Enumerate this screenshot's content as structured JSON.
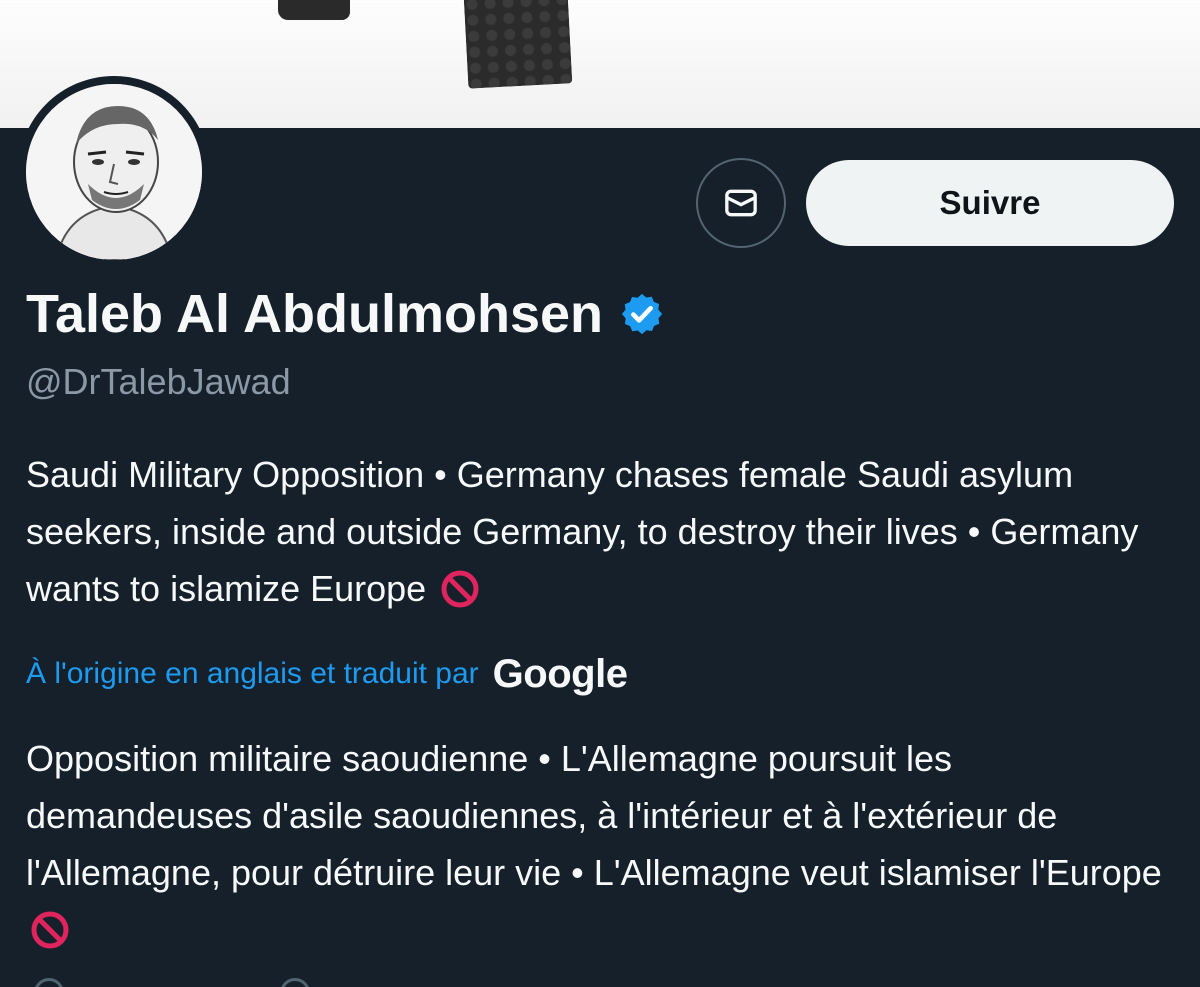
{
  "profile": {
    "display_name": "Taleb Al Abdulmohsen",
    "handle": "@DrTalebJawad",
    "verified_icon": "verified-badge-icon",
    "bio": "Saudi Military Opposition • Germany chases female Saudi asylum seekers, inside and outside Germany, to destroy their lives • Germany wants to islamize Europe",
    "translation_note": "À l'origine en anglais et traduit par",
    "translation_provider": "Google",
    "bio_translated": "Opposition militaire saoudienne • L'Allemagne poursuit les demandeuses d'asile saoudiennes, à l'intérieur et à l'extérieur de l'Allemagne, pour détruire leur vie • L'Allemagne veut islamiser l'Europe"
  },
  "actions": {
    "message_icon": "envelope-icon",
    "follow_label": "Suivre"
  },
  "colors": {
    "background": "#15202b",
    "accent": "#1d9bf0",
    "text_primary": "#f7f9f9",
    "text_secondary": "#8b98a5",
    "follow_bg": "#eff3f4",
    "prohibited": "#e0245e"
  }
}
